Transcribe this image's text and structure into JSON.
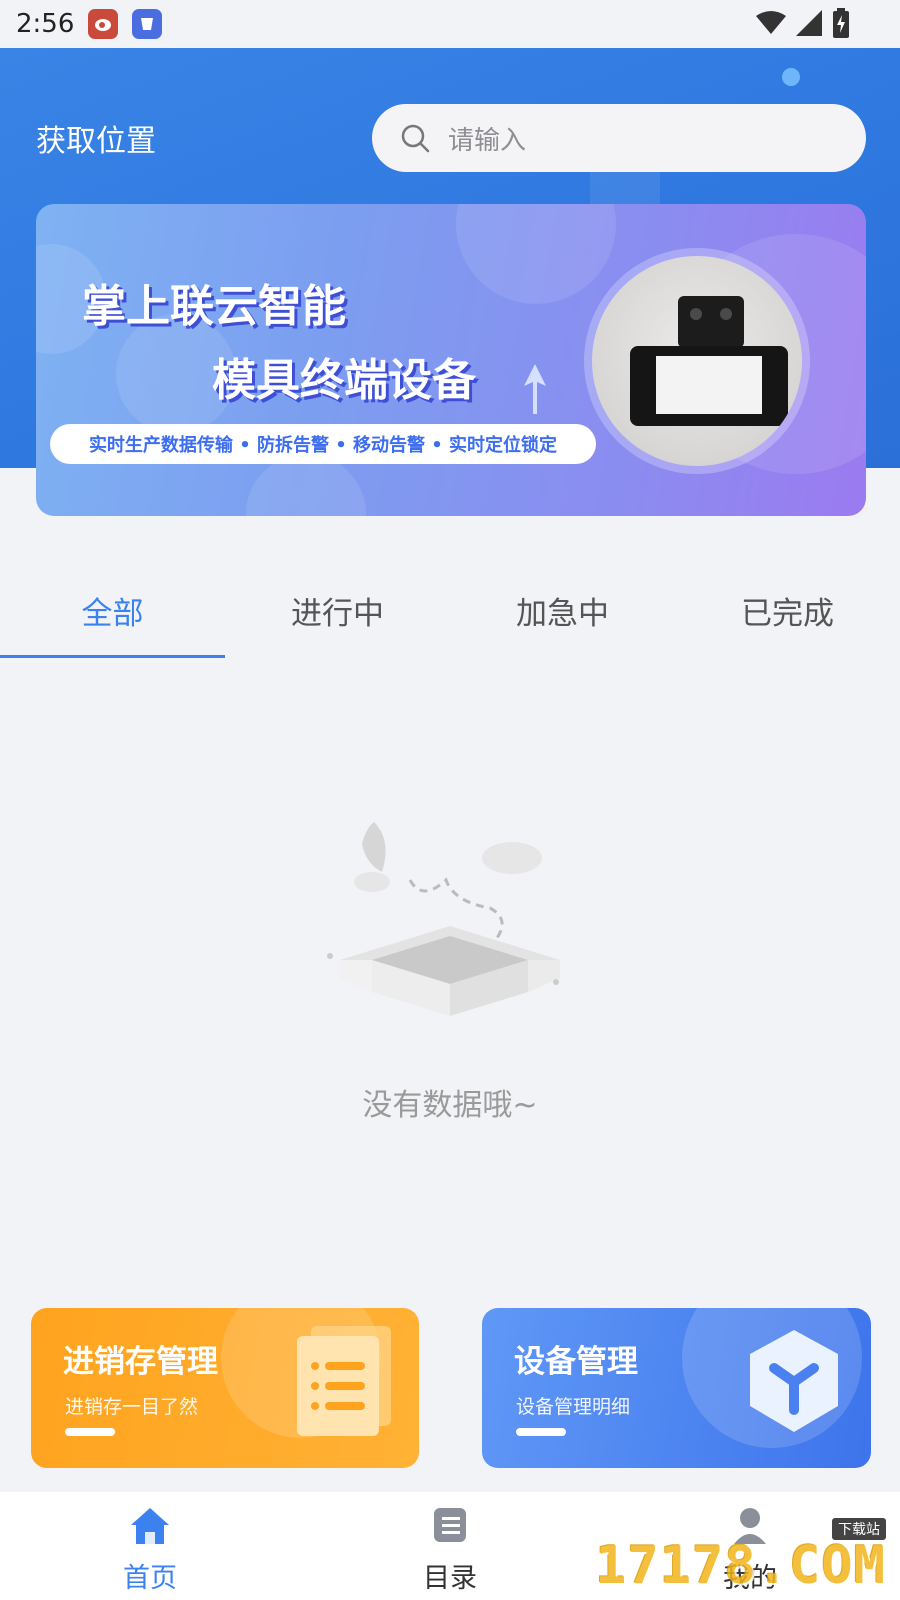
{
  "status_bar": {
    "time": "2:56"
  },
  "header": {
    "location_label": "获取位置",
    "search_placeholder": "请输入"
  },
  "banner": {
    "title_line1": "掌上联云智能",
    "title_line2": "模具终端设备",
    "features": "实时生产数据传输 • 防拆告警 • 移动告警 • 实时定位锁定"
  },
  "tabs": [
    {
      "label": "全部",
      "active": true
    },
    {
      "label": "进行中",
      "active": false
    },
    {
      "label": "加急中",
      "active": false
    },
    {
      "label": "已完成",
      "active": false
    }
  ],
  "empty_state": {
    "text": "没有数据哦~"
  },
  "cards": [
    {
      "title": "进销存管理",
      "subtitle": "进销存一目了然",
      "color": "#ffa31f"
    },
    {
      "title": "设备管理",
      "subtitle": "设备管理明细",
      "color": "#4a80f0"
    }
  ],
  "bottom_nav": [
    {
      "label": "首页",
      "icon": "home-icon",
      "active": true
    },
    {
      "label": "目录",
      "icon": "catalog-icon",
      "active": false
    },
    {
      "label": "我的",
      "icon": "profile-icon",
      "active": false
    }
  ],
  "watermark": {
    "text": "17178.COM",
    "tag": "下载站"
  },
  "colors": {
    "primary": "#3b82f0",
    "header": "#2f78e0",
    "orange": "#ffa31f"
  }
}
